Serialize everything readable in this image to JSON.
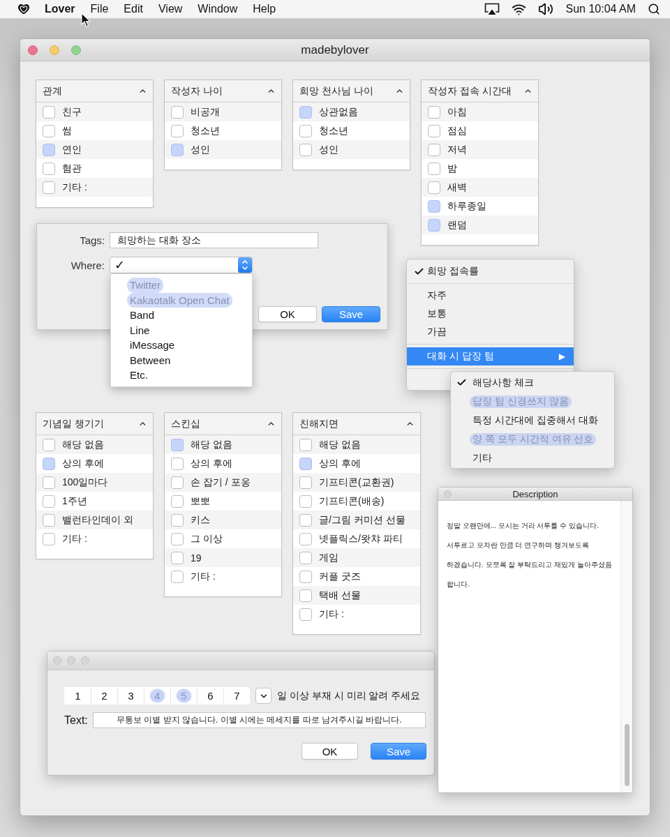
{
  "menu_bar": {
    "app_name": "Lover",
    "menus": [
      "File",
      "Edit",
      "View",
      "Window",
      "Help"
    ],
    "clock": "Sun 10:04 AM"
  },
  "window": {
    "title": "madebylover"
  },
  "top_lists": [
    {
      "title": "관계",
      "items": [
        {
          "label": "친구",
          "checked": false
        },
        {
          "label": "썸",
          "checked": false
        },
        {
          "label": "연인",
          "checked": true
        },
        {
          "label": "혐관",
          "checked": false
        },
        {
          "label": "기타 :",
          "checked": false
        }
      ]
    },
    {
      "title": "작성자 나이",
      "items": [
        {
          "label": "비공개",
          "checked": false
        },
        {
          "label": "청소년",
          "checked": false
        },
        {
          "label": "성인",
          "checked": true
        }
      ]
    },
    {
      "title": "희망 천사님 나이",
      "items": [
        {
          "label": "상관없음",
          "checked": true
        },
        {
          "label": "청소년",
          "checked": false
        },
        {
          "label": "성인",
          "checked": false
        }
      ]
    },
    {
      "title": "작성자 접속 시간대",
      "items": [
        {
          "label": "아침",
          "checked": false
        },
        {
          "label": "점심",
          "checked": false
        },
        {
          "label": "저녁",
          "checked": false
        },
        {
          "label": "밤",
          "checked": false
        },
        {
          "label": "새벽",
          "checked": false
        },
        {
          "label": "하루종일",
          "checked": true
        },
        {
          "label": "랜덤",
          "checked": true
        }
      ]
    }
  ],
  "tags_dialog": {
    "tags_label": "Tags:",
    "tags_value": "희망하는 대화 장소",
    "where_label": "Where:",
    "where_value": "✓",
    "options": [
      {
        "label": "Twitter",
        "highlighted": true
      },
      {
        "label": "Kakaotalk Open Chat",
        "highlighted": true
      },
      {
        "label": "Band",
        "highlighted": false
      },
      {
        "label": "Line",
        "highlighted": false
      },
      {
        "label": "iMessage",
        "highlighted": false
      },
      {
        "label": "Between",
        "highlighted": false
      },
      {
        "label": "Etc.",
        "highlighted": false
      }
    ],
    "buttons": [
      {
        "label": "OK",
        "primary": false
      },
      {
        "label": "Save",
        "primary": true
      }
    ]
  },
  "context_menu": {
    "items": [
      {
        "kind": "item",
        "label": "희망 접속률",
        "checked": true,
        "selected": false
      },
      {
        "kind": "separator"
      },
      {
        "kind": "item",
        "label": "자주",
        "checked": false,
        "selected": false
      },
      {
        "kind": "item",
        "label": "보통",
        "checked": false,
        "selected": false
      },
      {
        "kind": "item",
        "label": "가끔",
        "checked": false,
        "selected": false
      },
      {
        "kind": "separator"
      },
      {
        "kind": "submenu",
        "label": "대화 시 답장 텀",
        "arrow": "▶",
        "checked": false,
        "selected": true
      },
      {
        "kind": "separator"
      }
    ]
  },
  "submenu": {
    "items": [
      {
        "label": "해당사항 체크",
        "checked": true,
        "highlighted": false
      },
      {
        "label": "답장 텀 신경쓰지 않음",
        "checked": false,
        "highlighted": true
      },
      {
        "label": "특정 시간대에 집중해서 대화",
        "checked": false,
        "highlighted": false
      },
      {
        "label": "양 쪽 모두 시간적 여유 선호",
        "checked": false,
        "highlighted": true
      },
      {
        "label": "기타",
        "checked": false,
        "highlighted": false
      }
    ]
  },
  "bottom_lists": [
    {
      "title": "기념일 챙기기",
      "items": [
        {
          "label": "해당 없음",
          "checked": false
        },
        {
          "label": "상의 후에",
          "checked": true
        },
        {
          "label": "100일마다",
          "checked": false
        },
        {
          "label": "1주년",
          "checked": false
        },
        {
          "label": "밸런타인데이 외",
          "checked": false
        },
        {
          "label": "기타 :",
          "checked": false
        }
      ]
    },
    {
      "title": "스킨십",
      "items": [
        {
          "label": "해당 없음",
          "checked": true
        },
        {
          "label": "상의 후에",
          "checked": false
        },
        {
          "label": "손 잡기 / 포옹",
          "checked": false
        },
        {
          "label": "뽀뽀",
          "checked": false
        },
        {
          "label": "키스",
          "checked": false
        },
        {
          "label": "그 이상",
          "checked": false
        },
        {
          "label": "19",
          "checked": false
        },
        {
          "label": "기타 :",
          "checked": false
        }
      ]
    },
    {
      "title": "친해지면",
      "items": [
        {
          "label": "해당 없음",
          "checked": false
        },
        {
          "label": "상의 후에",
          "checked": true
        },
        {
          "label": "기프티콘(교환권)",
          "checked": false
        },
        {
          "label": "기프티콘(배송)",
          "checked": false
        },
        {
          "label": "글/그림 커미션 선물",
          "checked": false
        },
        {
          "label": "넷플릭스/왓챠 파티",
          "checked": false
        },
        {
          "label": "게임",
          "checked": false
        },
        {
          "label": "커플 굿즈",
          "checked": false
        },
        {
          "label": "택배 선물",
          "checked": false
        },
        {
          "label": "기타 :",
          "checked": false
        }
      ]
    }
  ],
  "absence_dialog": {
    "days": [
      {
        "label": "1",
        "highlighted": false
      },
      {
        "label": "2",
        "highlighted": false
      },
      {
        "label": "3",
        "highlighted": false
      },
      {
        "label": "4",
        "highlighted": true
      },
      {
        "label": "5",
        "highlighted": true
      },
      {
        "label": "6",
        "highlighted": false
      },
      {
        "label": "7",
        "highlighted": false
      }
    ],
    "suffix": "일 이상 부재 시 미리 알려 주세요",
    "text_label": "Text:",
    "text_value": "무통보 이별 받지 않습니다. 이별 시에는 메세지를 따로 남겨주시길 바랍니다.",
    "buttons": [
      {
        "label": "OK",
        "primary": false
      },
      {
        "label": "Save",
        "primary": true
      }
    ]
  },
  "description_window": {
    "title": "Description",
    "text": "정말 오랜만에... 모시는 거라 서투를 수 있습니다. 서투르고 모자란 만큼 더 연구하며 챙겨보도록 하겠습니다. 모쪼록 잘 부탁드리고 재밌게 놀아주셨음 합니다."
  }
}
